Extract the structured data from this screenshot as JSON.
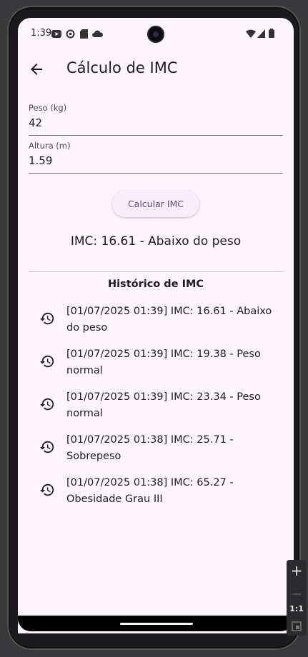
{
  "status_bar": {
    "time": "1:39"
  },
  "app_bar": {
    "title": "Cálculo de IMC"
  },
  "form": {
    "weight": {
      "label": "Peso (kg)",
      "value": "42"
    },
    "height": {
      "label": "Altura (m)",
      "value": "1.59"
    }
  },
  "calculate_button": {
    "label": "Calcular IMC"
  },
  "result": "IMC: 16.61 - Abaixo do peso",
  "history": {
    "title": "Histórico de IMC",
    "items": [
      {
        "line1": "[01/07/2025 01:39] IMC: 16.61 - Abaixo",
        "line2": "do peso",
        "icon": "history-icon"
      },
      {
        "line1": "[01/07/2025 01:39] IMC: 19.38 - Peso",
        "line2": "normal",
        "icon": "history-icon"
      },
      {
        "line1": "[01/07/2025 01:39] IMC: 23.34 - Peso",
        "line2": "normal",
        "icon": "history-icon"
      },
      {
        "line1": "[01/07/2025 01:38] IMC: 25.71 -",
        "line2": "Sobrepeso",
        "icon": "history-icon"
      },
      {
        "line1": "[01/07/2025 01:38] IMC: 65.27 -",
        "line2": "Obesidade Grau III",
        "icon": "history-icon"
      }
    ]
  },
  "emulator_tools": {
    "zoom_in": "+",
    "zoom_reset": "1:1"
  },
  "colors": {
    "background": "#fdf6fc",
    "button_text": "#5b4b8a",
    "button_bg": "#f6eef8"
  }
}
